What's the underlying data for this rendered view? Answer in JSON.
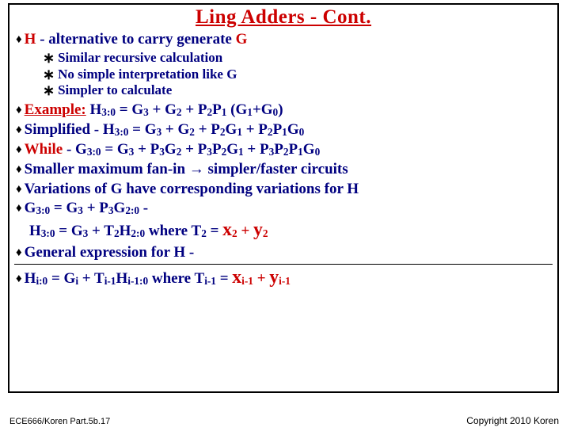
{
  "title": "Ling Adders - Cont.",
  "line1_pre": "H",
  "line1_mid": " - alternative to carry generate ",
  "line1_post": "G",
  "sub1": "Similar recursive calculation",
  "sub2": "No simple interpretation like G",
  "sub3": "Simpler to calculate",
  "ex_label": "Example:",
  "ex_rest_a": " H",
  "ex_rest_b": "3:0",
  "ex_rest_c": " = G",
  "ex_rest_d": "3",
  "ex_rest_e": " + G",
  "ex_rest_f": "2",
  "ex_rest_g": " + P",
  "ex_rest_h": "2",
  "ex_rest_i": "P",
  "ex_rest_j": "1",
  "ex_rest_k": " (G",
  "ex_rest_l": "1",
  "ex_rest_m": "+G",
  "ex_rest_n": "0",
  "ex_rest_o": ")",
  "simp_a": "Simplified -",
  "simp_b": "  H",
  "simp_c": "3:0",
  "simp_d": " = G",
  "simp_e": "3",
  "simp_f": " + G",
  "simp_g": "2",
  "simp_h": " + P",
  "simp_i": "2",
  "simp_j": "G",
  "simp_k": "1",
  "simp_l": " + P",
  "simp_m": "2",
  "simp_n": "P",
  "simp_o": "1",
  "simp_p": "G",
  "simp_q": "0",
  "while_a": "While",
  "while_b": "  -",
  "while_c": " G",
  "while_d": "3:0",
  "while_e": " = G",
  "while_f": "3",
  "while_g": " + P",
  "while_h": "3",
  "while_i": "G",
  "while_j": "2",
  "while_k": " + P",
  "while_l": "3",
  "while_m": "P",
  "while_n": "2",
  "while_o": "G",
  "while_p": "1",
  "while_q": " + P",
  "while_r": "3",
  "while_s": "P",
  "while_t": "2",
  "while_u": "P",
  "while_v": "1",
  "while_w": "G",
  "while_x": "0",
  "fanin_a": "Smaller maximum fan-in ",
  "fanin_arrow": "→",
  "fanin_b": " simpler/faster circuits",
  "var_line": "Variations of G have corresponding variations for H",
  "eq1_a": "G",
  "eq1_b": "3:0",
  "eq1_c": " = G",
  "eq1_d": "3",
  "eq1_e": " + P",
  "eq1_f": "3",
  "eq1_g": "G",
  "eq1_h": "2:0",
  "eq1_i": "   -",
  "eq2_a": "H",
  "eq2_b": "3:0",
  "eq2_c": " = G",
  "eq2_d": "3",
  "eq2_e": " + T",
  "eq2_f": "2",
  "eq2_g": "H",
  "eq2_h": "2:0",
  "eq2_i": "   where  T",
  "eq2_j": "2",
  "eq2_k": " = ",
  "eq2_l": "x",
  "eq2_m": "2",
  "eq2_n": " + ",
  "eq2_o": "y",
  "eq2_p": "2",
  "gen_line": "General expression for H -",
  "final_a": "H",
  "final_b": "i:0",
  "final_c": " = G",
  "final_d": "i",
  "final_e": " + T",
  "final_f": "i-1",
  "final_g": "H",
  "final_h": "i-1:0",
  "final_i": "   where T",
  "final_j": "i-1",
  "final_k": " = ",
  "final_l": "x",
  "final_m": "i-1",
  "final_n": " + ",
  "final_o": "y",
  "final_p": "i-1",
  "footer_left": "ECE666/Koren Part.5b.17",
  "footer_right": "Copyright 2010 Koren"
}
